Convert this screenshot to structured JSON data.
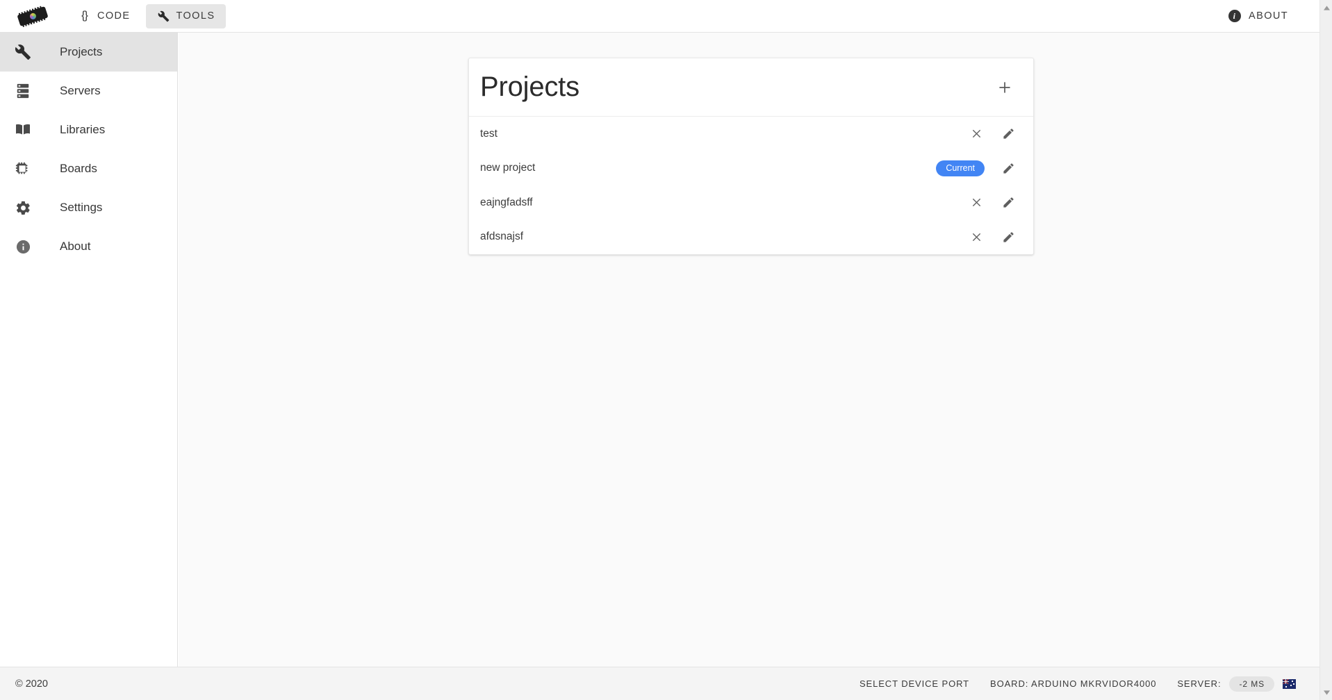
{
  "topbar": {
    "logo_icon": "arduino-chip-logo",
    "tabs": [
      {
        "label": "CODE",
        "icon": "braces-icon",
        "active": false
      },
      {
        "label": "TOOLS",
        "icon": "wrench-icon",
        "active": true
      }
    ],
    "about": {
      "label": "ABOUT",
      "icon": "info-icon"
    }
  },
  "sidebar": {
    "items": [
      {
        "label": "Projects",
        "icon": "wrench-icon",
        "active": true
      },
      {
        "label": "Servers",
        "icon": "server-icon",
        "active": false
      },
      {
        "label": "Libraries",
        "icon": "book-icon",
        "active": false
      },
      {
        "label": "Boards",
        "icon": "chip-icon",
        "active": false
      },
      {
        "label": "Settings",
        "icon": "gear-icon",
        "active": false
      },
      {
        "label": "About",
        "icon": "info-icon",
        "active": false
      }
    ]
  },
  "main": {
    "card": {
      "title": "Projects",
      "add_icon": "plus-icon",
      "rows": [
        {
          "name": "test",
          "current": false,
          "badge": "",
          "delete_icon": "close-icon",
          "edit_icon": "pencil-icon"
        },
        {
          "name": "new project",
          "current": true,
          "badge": "Current",
          "delete_icon": "",
          "edit_icon": "pencil-icon"
        },
        {
          "name": "eajngfadsff",
          "current": false,
          "badge": "",
          "delete_icon": "close-icon",
          "edit_icon": "pencil-icon"
        },
        {
          "name": "afdsnajsf",
          "current": false,
          "badge": "",
          "delete_icon": "close-icon",
          "edit_icon": "pencil-icon"
        }
      ]
    }
  },
  "footer": {
    "copyright": "© 2020",
    "select_device_port": "SELECT DEVICE PORT",
    "board": "BOARD: ARDUINO MKRVIDOR4000",
    "server_label": "SERVER:",
    "latency": "-2 MS",
    "flag_icon": "australia-flag-icon"
  },
  "colors": {
    "accent": "#4285f4",
    "sidebar_active": "#e3e3e3",
    "tab_active": "#e6e6e6",
    "canvas": "#fafafa",
    "footer_bg": "#f4f4f4"
  }
}
